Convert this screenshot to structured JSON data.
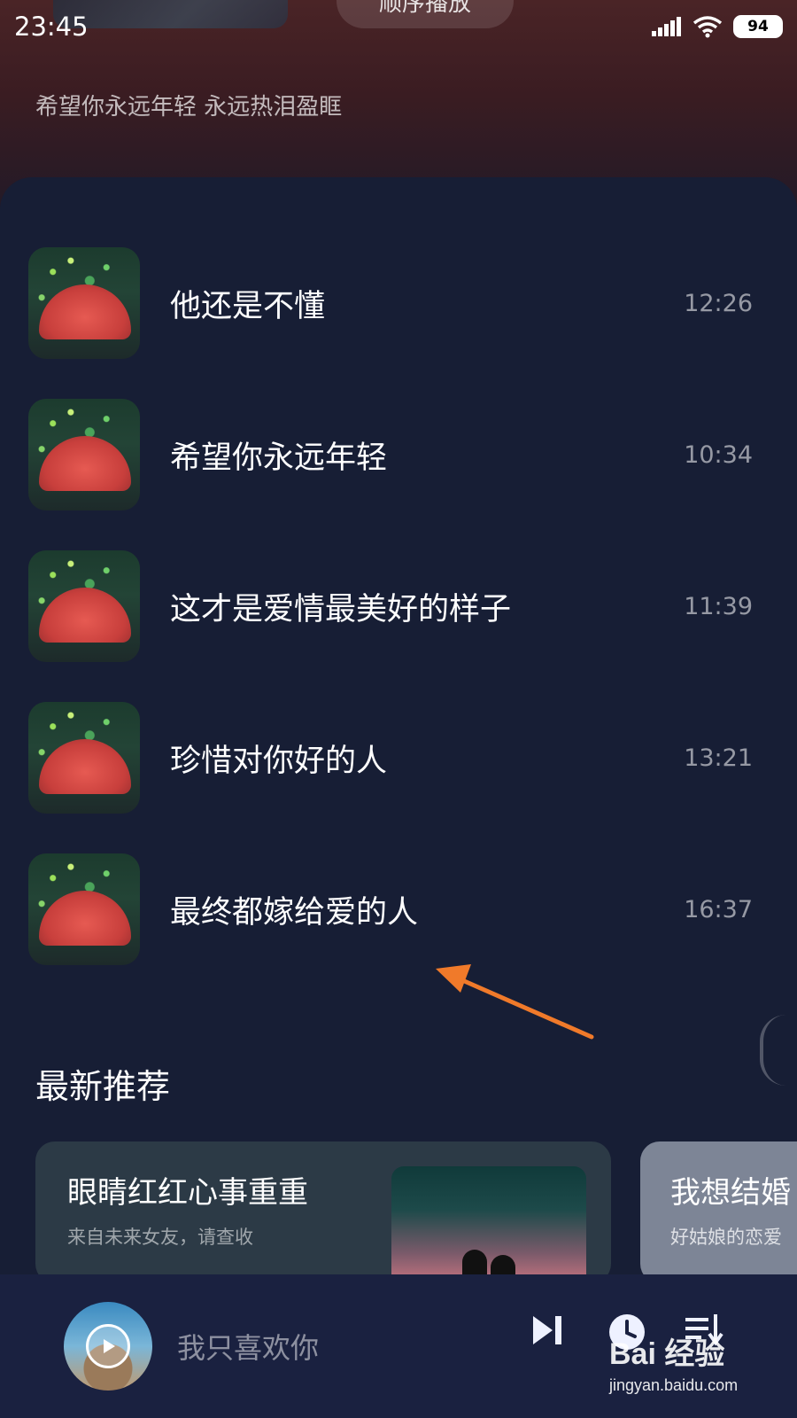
{
  "status_bar": {
    "time": "23:45",
    "battery": "94"
  },
  "header": {
    "play_order_label": "顺序播放",
    "subtitle": "希望你永远年轻 永远热泪盈眶"
  },
  "songs": [
    {
      "title": "他还是不懂",
      "duration": "12:26"
    },
    {
      "title": "希望你永远年轻",
      "duration": "10:34"
    },
    {
      "title": "这才是爱情最美好的样子",
      "duration": "11:39"
    },
    {
      "title": "珍惜对你好的人",
      "duration": "13:21"
    },
    {
      "title": "最终都嫁给爱的人",
      "duration": "16:37"
    }
  ],
  "recommend": {
    "section_title": "最新推荐",
    "cards": [
      {
        "title": "眼睛红红心事重重",
        "subtitle": "来自未来女友，请查收"
      },
      {
        "title": "我想结婚",
        "subtitle": "好姑娘的恋爱"
      }
    ]
  },
  "player": {
    "now_playing": "我只喜欢你"
  },
  "watermark": {
    "logo": "Bai 经验",
    "url": "jingyan.baidu.com"
  },
  "colors": {
    "background": "#161d33",
    "accent_arrow": "#f07a2a",
    "player_bar": "#1a2140"
  },
  "icons": [
    "signal-icon",
    "wifi-icon",
    "battery-icon",
    "play-icon",
    "next-icon",
    "timer-icon",
    "playlist-icon"
  ]
}
